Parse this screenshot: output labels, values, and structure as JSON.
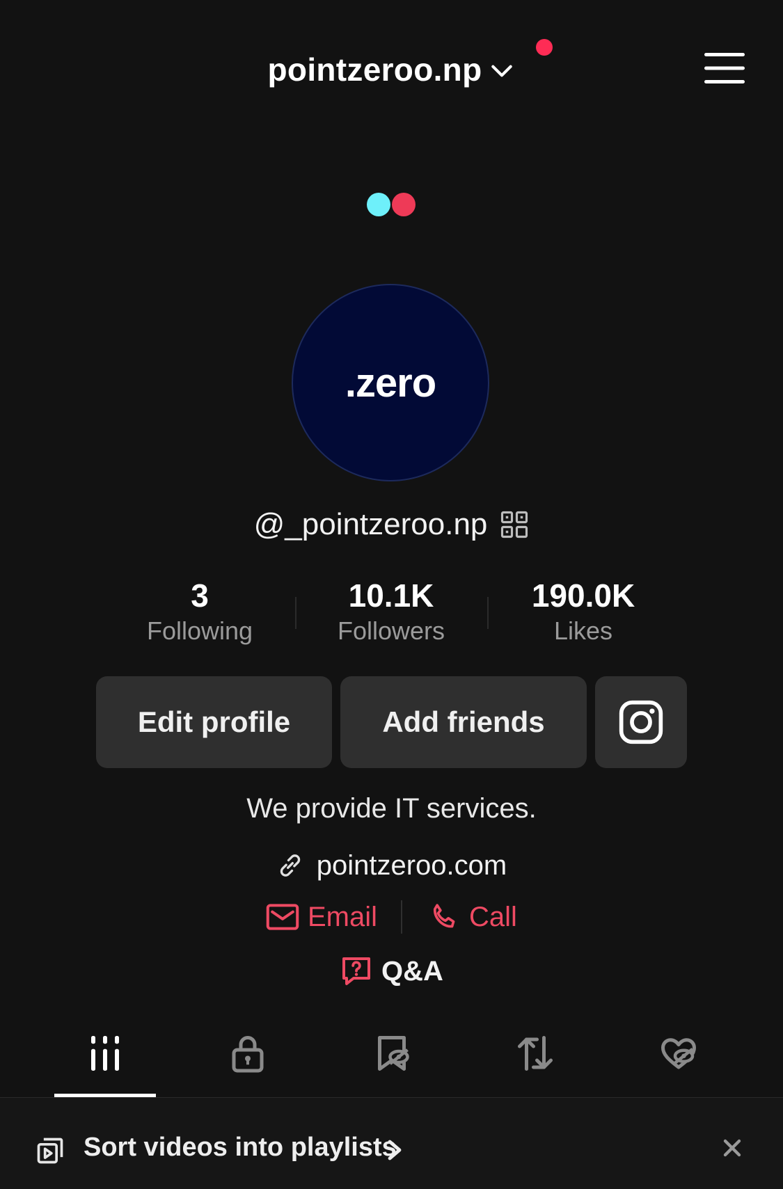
{
  "header": {
    "account_name": "pointzeroo.np",
    "notification_color": "#fe2c55",
    "icons": [
      "chevron-down-icon",
      "menu-icon"
    ]
  },
  "profile": {
    "avatar_text": ".zero",
    "avatar_bg": "#020a36",
    "username": "@_pointzeroo.np",
    "stats": [
      {
        "value": "3",
        "label": "Following"
      },
      {
        "value": "10.1K",
        "label": "Followers"
      },
      {
        "value": "190.0K",
        "label": "Likes"
      }
    ],
    "buttons": {
      "edit_profile": "Edit profile",
      "add_friends": "Add friends",
      "instagram_icon": "instagram-icon"
    },
    "bio": "We provide IT services.",
    "website": "pointzeroo.com",
    "contact": {
      "email": "Email",
      "call": "Call",
      "accent": "#ee4a63"
    },
    "qa": "Q&A"
  },
  "tabs": [
    {
      "icon": "videos-grid-icon",
      "active": true
    },
    {
      "icon": "lock-icon",
      "active": false
    },
    {
      "icon": "saved-hidden-icon",
      "active": false
    },
    {
      "icon": "repost-icon",
      "active": false
    },
    {
      "icon": "liked-hidden-icon",
      "active": false
    }
  ],
  "banner": {
    "text": "Sort videos into playlists"
  }
}
